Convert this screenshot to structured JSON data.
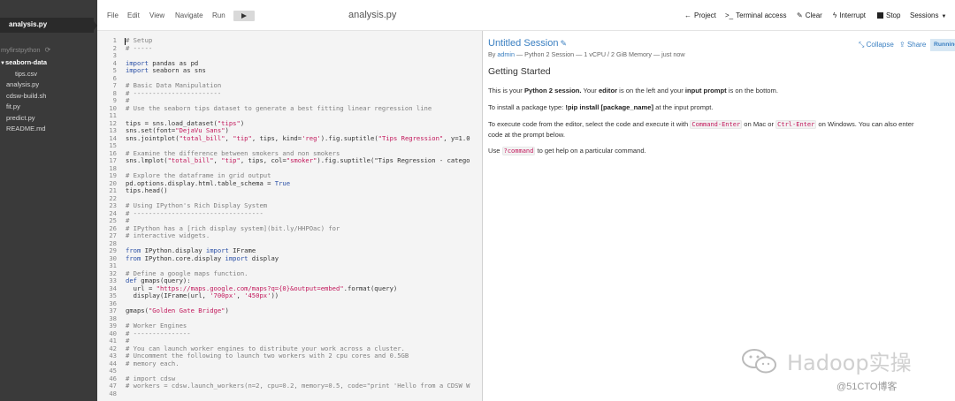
{
  "sidebar": {
    "active_file": "analysis.py",
    "project": "myfirstpython",
    "items": [
      {
        "label": "seaborn-data",
        "type": "folder"
      },
      {
        "label": "tips.csv",
        "type": "file"
      },
      {
        "label": "analysis.py",
        "type": "file"
      },
      {
        "label": "cdsw-build.sh",
        "type": "file"
      },
      {
        "label": "fit.py",
        "type": "file"
      },
      {
        "label": "predict.py",
        "type": "file"
      },
      {
        "label": "README.md",
        "type": "file"
      }
    ]
  },
  "editor": {
    "menus": [
      "File",
      "Edit",
      "View",
      "Navigate",
      "Run"
    ],
    "file_title": "analysis.py",
    "lines": [
      "# Setup",
      "# -----",
      "",
      "import pandas as pd",
      "import seaborn as sns",
      "",
      "# Basic Data Manipulation",
      "# -----------------------",
      "#",
      "# Use the seaborn tips dataset to generate a best fitting linear regression line",
      "",
      "tips = sns.load_dataset(\"tips\")",
      "sns.set(font=\"DejaVu Sans\")",
      "sns.jointplot(\"total_bill\", \"tip\", tips, kind='reg').fig.suptitle(\"Tips Regression\", y=1.0",
      "",
      "# Examine the difference between smokers and non smokers",
      "sns.lmplot(\"total_bill\", \"tip\", tips, col=\"smoker\").fig.suptitle(\"Tips Regression - catego",
      "",
      "# Explore the dataframe in grid output",
      "pd.options.display.html.table_schema = True",
      "tips.head()",
      "",
      "# Using IPython's Rich Display System",
      "# ----------------------------------",
      "#",
      "# IPython has a [rich display system](bit.ly/HHPOac) for",
      "# interactive widgets.",
      "",
      "from IPython.display import IFrame",
      "from IPython.core.display import display",
      "",
      "# Define a google maps function.",
      "def gmaps(query):",
      "  url = \"https://maps.google.com/maps?q={0}&output=embed\".format(query)",
      "  display(IFrame(url, '700px', '450px'))",
      "",
      "gmaps(\"Golden Gate Bridge\")",
      "",
      "# Worker Engines",
      "# ---------------",
      "#",
      "# You can launch worker engines to distribute your work across a cluster.",
      "# Uncomment the following to launch two workers with 2 cpu cores and 0.5GB",
      "# memory each.",
      "",
      "# import cdsw",
      "# workers = cdsw.launch_workers(n=2, cpu=0.2, memory=0.5, code=\"print 'Hello from a CDSW W",
      ""
    ]
  },
  "session_toolbar": {
    "project": "Project",
    "terminal": "Terminal access",
    "clear": "Clear",
    "interrupt": "Interrupt",
    "stop": "Stop",
    "sessions": "Sessions"
  },
  "session": {
    "title": "Untitled Session",
    "by": "By",
    "user": "admin",
    "meta": "— Python 2 Session — 1 vCPU / 2 GiB Memory — just now",
    "collapse": "Collapse",
    "share": "Share",
    "status": "Running",
    "heading": "Getting Started",
    "p1_a": "This is your ",
    "p1_b": "Python 2 session.",
    "p1_c": " Your ",
    "p1_d": "editor",
    "p1_e": " is on the left and your ",
    "p1_f": "input prompt",
    "p1_g": " is on the bottom.",
    "p2_a": "To install a package type: ",
    "p2_b": "!pip install [package_name]",
    "p2_c": " at the input prompt.",
    "p3_a": "To execute code from the editor, select the code and execute it with ",
    "p3_b": "Command-Enter",
    "p3_c": " on Mac or ",
    "p3_d": "Ctrl-Enter",
    "p3_e": " on Windows. You can also enter code at the prompt below.",
    "p4_a": "Use ",
    "p4_b": "?command",
    "p4_c": " to get help on a particular command."
  },
  "watermark": {
    "text": "Hadoop实操",
    "sub": "@51CTO博客"
  }
}
